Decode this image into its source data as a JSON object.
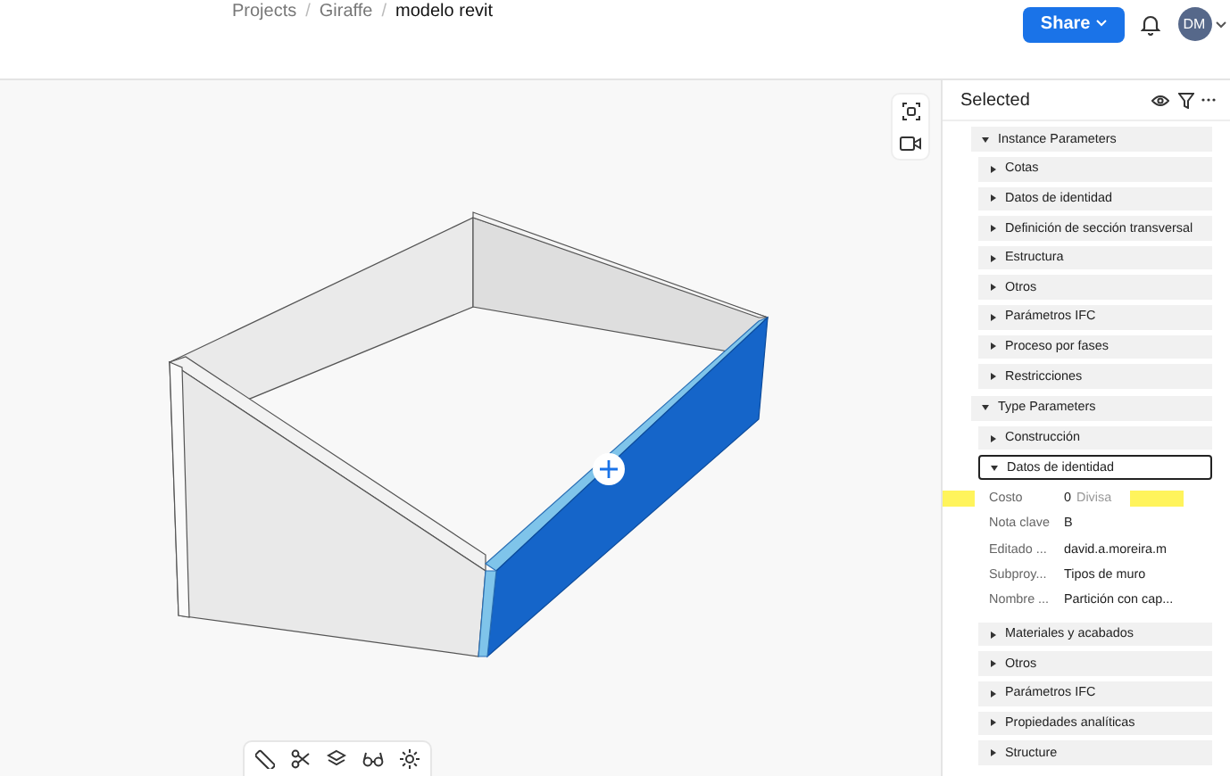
{
  "breadcrumb": [
    "Projects",
    "Giraffe",
    "modelo revit"
  ],
  "breadcrumb_separator": "/",
  "share_button": "Share",
  "avatar": "DM",
  "panel": {
    "title": "Selected",
    "groups": [
      {
        "label": "Instance Parameters",
        "expanded": true,
        "children": [
          {
            "label": "Cotas",
            "expanded": false,
            "focused": false
          },
          {
            "label": "Datos de identidad",
            "expanded": false,
            "focused": false
          },
          {
            "label": "Definición de sección transversal",
            "expanded": false,
            "focused": false
          },
          {
            "label": "Estructura",
            "expanded": false,
            "focused": false
          },
          {
            "label": "Otros",
            "expanded": false,
            "focused": false
          },
          {
            "label": "Parámetros IFC",
            "expanded": false,
            "focused": false
          },
          {
            "label": "Proceso por fases",
            "expanded": false,
            "focused": false
          },
          {
            "label": "Restricciones",
            "expanded": false,
            "focused": false
          }
        ]
      },
      {
        "label": "Type Parameters",
        "expanded": true,
        "children": [
          {
            "label": "Construcción",
            "expanded": false,
            "focused": false
          },
          {
            "label": "Datos de identidad",
            "expanded": true,
            "focused": true,
            "properties": [
              {
                "name": "Costo",
                "value": "0",
                "unit": "Divisa",
                "highlighted": true
              },
              {
                "name": "Nota clave",
                "value": "B",
                "highlighted": false
              },
              {
                "name": "Editado ...",
                "value": "david.a.moreira.m",
                "highlighted": false
              },
              {
                "name": "Subproy...",
                "value": "Tipos de muro",
                "highlighted": false
              },
              {
                "name": "Nombre ...",
                "value": "Partición con cap...",
                "highlighted": false
              }
            ]
          },
          {
            "label": "Materiales y acabados",
            "expanded": false,
            "focused": false
          },
          {
            "label": "Otros",
            "expanded": false,
            "focused": false
          },
          {
            "label": "Parámetros IFC",
            "expanded": false,
            "focused": false
          },
          {
            "label": "Propiedades analíticas",
            "expanded": false,
            "focused": false
          },
          {
            "label": "Structure",
            "expanded": false,
            "focused": false
          }
        ]
      }
    ]
  }
}
